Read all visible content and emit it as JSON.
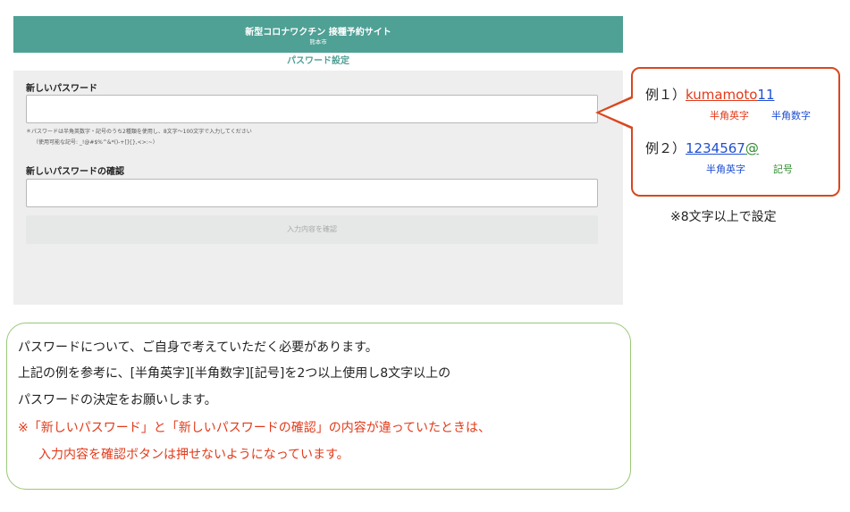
{
  "header": {
    "title": "新型コロナワクチン 接種予約サイト",
    "city": "熊本市"
  },
  "page_subtitle": "パスワード設定",
  "form": {
    "new_password_label": "新しいパスワード",
    "new_password_value": "",
    "new_password_note_1": "＊パスワードは半角英数字・記号のうち2種類を使用し、8文字〜100文字で入力してください",
    "new_password_note_2": "（使用可能な記号: _!@#$%^&*()-+[]{},<>:~）",
    "confirm_password_label": "新しいパスワードの確認",
    "confirm_password_value": "",
    "confirm_button_label": "入力内容を確認"
  },
  "callout": {
    "example1": {
      "prefix": "例１）",
      "alpha": "kumamoto",
      "digits": "11",
      "alpha_caption": "半角英字",
      "digit_caption": "半角数字"
    },
    "example2": {
      "prefix": "例２）",
      "digits": "1234567",
      "symbol": "@",
      "digit_caption": "半角英字",
      "symbol_caption": "記号"
    },
    "min_length_note": "※8文字以上で設定"
  },
  "info": {
    "line1": "パスワードについて、ご自身で考えていただく必要があります。",
    "line2": "上記の例を参考に、[半角英字][半角数字][記号]を2つ以上使用し8文字以上の",
    "line3": "パスワードの決定をお願いします。",
    "warning1": "※「新しいパスワード」と「新しいパスワードの確認」の内容が違っていたときは、",
    "warning2": "入力内容を確認ボタンは押せないようになっています。"
  },
  "colors": {
    "header_bg": "#4fa095",
    "callout_border": "#d9471f",
    "alpha_red": "#e13a1a",
    "digit_blue": "#1f4fd1",
    "symbol_green": "#2e8a2e",
    "info_border": "#9ac878"
  }
}
